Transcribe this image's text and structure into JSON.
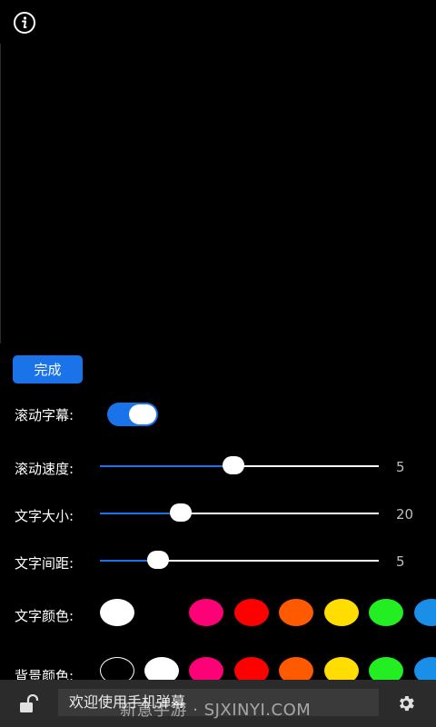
{
  "done_label": "完成",
  "settings": {
    "scroll_label": "滚动字幕:",
    "scroll_enabled": true,
    "speed_label": "滚动速度:",
    "speed_value": "5",
    "speed_fraction": 0.44,
    "size_label": "文字大小:",
    "size_value": "20",
    "size_fraction": 0.25,
    "spacing_label": "文字间距:",
    "spacing_value": "5",
    "spacing_fraction": 0.17,
    "text_color_label": "文字颜色:",
    "bg_color_label": "背景颜色:"
  },
  "colors": {
    "text": [
      "#ffffff",
      "#ff0077",
      "#ff0000",
      "#ff5a00",
      "#ffdd00",
      "#22ee22",
      "#1a8fe8"
    ],
    "background": [
      "#000000",
      "#ffffff",
      "#ff0077",
      "#ff0000",
      "#ff5a00",
      "#ffdd00",
      "#22ee22",
      "#1a8fe8"
    ],
    "accent": "#1a73e8"
  },
  "bottom": {
    "input_value": "欢迎使用手机弹幕",
    "watermark": "新意手游 · SJXINYI.COM"
  },
  "icons": {
    "info": "info-icon",
    "lock": "unlock-icon",
    "gear": "gear-icon"
  }
}
